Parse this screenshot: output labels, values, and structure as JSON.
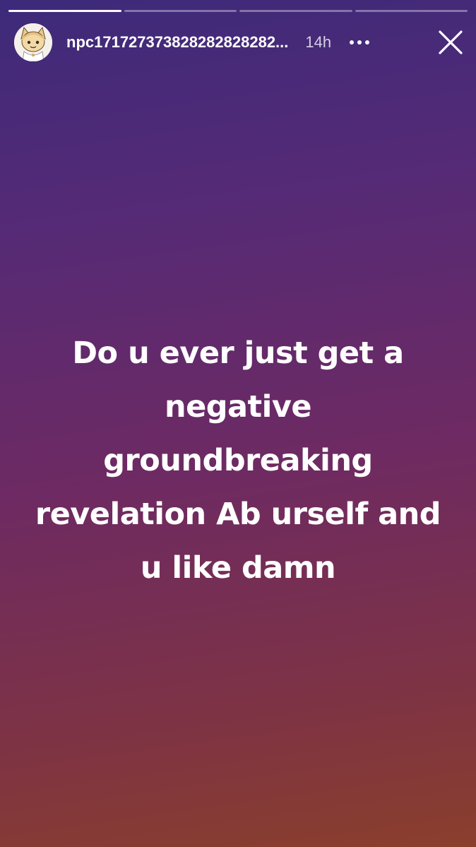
{
  "story": {
    "progress": [
      1,
      0,
      0,
      0
    ],
    "username": "npc171727373828282828282...",
    "time_ago": "14h",
    "more_icon": "more-dots-icon",
    "close_icon": "close-x-icon",
    "avatar_icon": "anime-cat-avatar",
    "caption_lines": [
      "Do u ever just get a",
      "negative",
      "groundbreaking",
      "revelation Ab urself and",
      "u like damn"
    ]
  },
  "colors": {
    "gradient_top": "#3d2a7a",
    "gradient_bottom": "#8a3f2c",
    "text": "#ffffff"
  }
}
